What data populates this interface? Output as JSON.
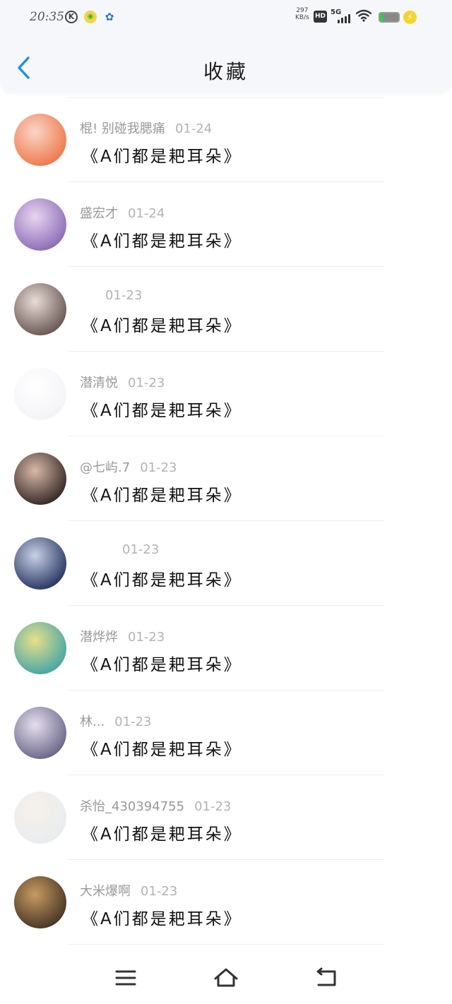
{
  "status_bar": {
    "time": "20:35",
    "speed_value": "297",
    "speed_unit": "KB/s",
    "hd_label": "HD",
    "network_label": "5G",
    "icons": [
      "k-app-icon",
      "owl-app-icon",
      "paw-app-icon",
      "signal-icon",
      "wifi-icon",
      "battery-icon",
      "charging-icon"
    ]
  },
  "header": {
    "title": "收藏",
    "back_icon": "chevron-left-icon"
  },
  "favorites": [
    {
      "user": "棍!  别碰我腮痛",
      "date": "01-24",
      "content": "《A们都是耙耳朵》",
      "avatar_color": "#f07a4e",
      "avatar_color2": "#f9d6c8"
    },
    {
      "user": "盛宏才",
      "date": "01-24",
      "content": "《A们都是耙耳朵》",
      "avatar_color": "#8e6fb8",
      "avatar_color2": "#e8d5f0"
    },
    {
      "user": "",
      "date": "01-23",
      "content": "《A们都是耙耳朵》",
      "avatar_color": "#6b5a55",
      "avatar_color2": "#e9dcd6"
    },
    {
      "user": "潜清悦",
      "date": "01-23",
      "content": "《A们都是耙耳朵》",
      "avatar_color": "#f4f4f8",
      "avatar_color2": "#ffffff"
    },
    {
      "user": "@七屿.7",
      "date": "01-23",
      "content": "《A们都是耙耳朵》",
      "avatar_color": "#3a2b28",
      "avatar_color2": "#d8b9a8"
    },
    {
      "user": "",
      "date": "01-23",
      "content": "《A们都是耙耳朵》",
      "avatar_color": "#2b3a66",
      "avatar_color2": "#c9d1e6"
    },
    {
      "user": "潜烨烨",
      "date": "01-23",
      "content": "《A们都是耙耳朵》",
      "avatar_color": "#4aa7a6",
      "avatar_color2": "#e8e08a"
    },
    {
      "user": "林...",
      "date": "01-23",
      "content": "《A们都是耙耳朵》",
      "avatar_color": "#6d6a8a",
      "avatar_color2": "#e7dff0"
    },
    {
      "user": "杀怡_430394755",
      "date": "01-23",
      "content": "《A们都是耙耳朵》",
      "avatar_color": "#e9ecef",
      "avatar_color2": "#f7f1ea"
    },
    {
      "user": "大米爆啊",
      "date": "01-23",
      "content": "《A们都是耙耳朵》",
      "avatar_color": "#4a3826",
      "avatar_color2": "#c99a62"
    }
  ],
  "bottom_nav": {
    "icons": [
      "menu-icon",
      "home-icon",
      "back-icon"
    ]
  }
}
